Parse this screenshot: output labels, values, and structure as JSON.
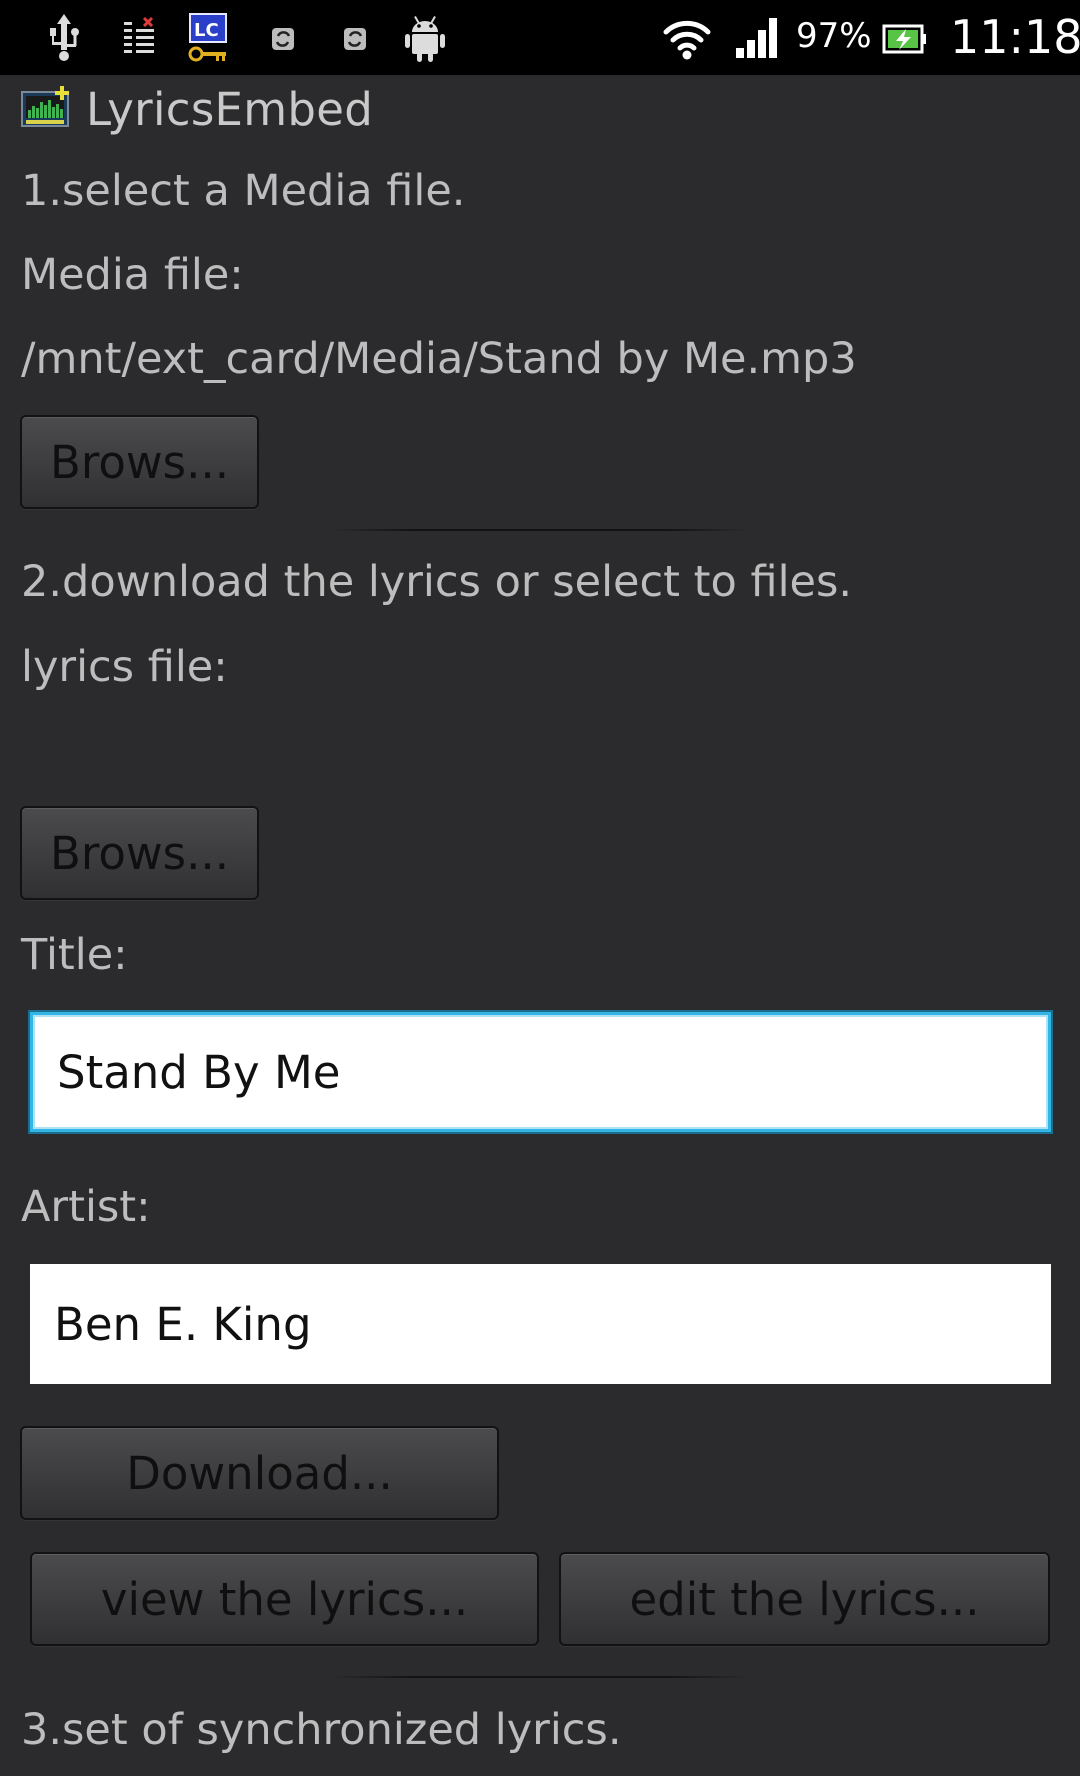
{
  "status_bar": {
    "icons": [
      "usb-icon",
      "task-manager-icon",
      "lucky-patcher-icon",
      "sync-icon",
      "sync-icon",
      "android-icon",
      "wifi-icon",
      "cell-signal-icon",
      "battery-charging-icon"
    ],
    "battery": "97%",
    "time": "11:18"
  },
  "app": {
    "title": "LyricsEmbed",
    "icon": "lyrics-embed-app-icon"
  },
  "step1": {
    "heading": "1.select a Media file.",
    "media_label": "Media file:",
    "media_path": "/mnt/ext_card/Media/Stand by Me.mp3",
    "browse_label": "Brows..."
  },
  "step2": {
    "heading": "2.download the lyrics or select to files.",
    "lyrics_label": "lyrics file:",
    "lyrics_path": "",
    "browse_label": "Brows...",
    "title_label": "Title:",
    "title_value": "Stand By Me",
    "artist_label": "Artist:",
    "artist_value": "Ben E. King",
    "download_label": "Download...",
    "view_label": "view the lyrics...",
    "edit_label": "edit the lyrics..."
  },
  "step3": {
    "heading": "3.set of synchronized lyrics."
  },
  "colors": {
    "background": "#2b2b2d",
    "focus_accent": "#33b5e5",
    "text_secondary": "#bdbdbd"
  }
}
